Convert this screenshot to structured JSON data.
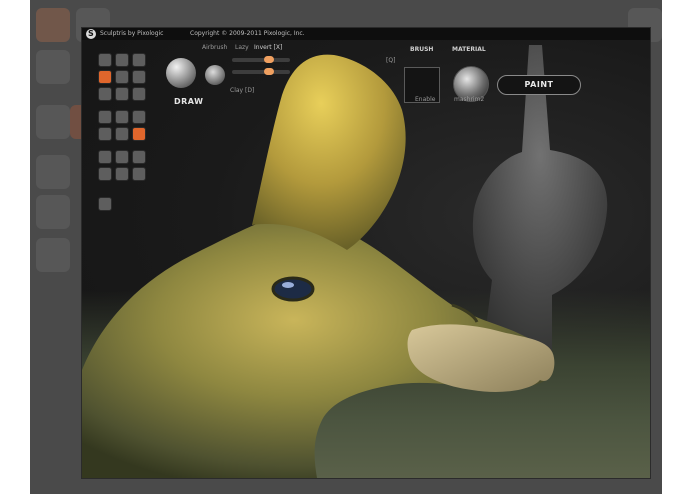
{
  "window": {
    "app_title": "Sculptris by Pixologic",
    "copyright": "Copyright © 2009-2011 Pixologic, Inc."
  },
  "brush": {
    "tool_label": "DRAW",
    "airbrush_label": "Airbrush",
    "lazy_label": "Lazy",
    "invert_label": "Invert [X]",
    "clay_label": "Clay [D]",
    "hidden_shortcut": "[Q]"
  },
  "brush_panel": {
    "header": "BRUSH",
    "enable_label": "Enable"
  },
  "material_panel": {
    "header": "MATERIAL",
    "name": "mashrim2"
  },
  "actions": {
    "paint_label": "PAINT"
  },
  "colors": {
    "accent_orange": "#e0662c",
    "panel_bg": "#1f1f1f",
    "knob": "#f0a060"
  },
  "toolbar_icons": [
    "crease-icon",
    "rotate-icon",
    "scale-icon",
    "draw-icon",
    "flatten-icon",
    "grab-icon",
    "inflate-icon",
    "pinch-icon",
    "smooth-icon",
    "reduce-icon",
    "mask-icon",
    "symmetry-icon",
    "wireframe-icon",
    "close-icon",
    "swap-icon",
    "sphere-icon",
    "pan-icon",
    "line-icon",
    "link-icon",
    "grid-icon",
    "layers-icon",
    "image-icon"
  ]
}
